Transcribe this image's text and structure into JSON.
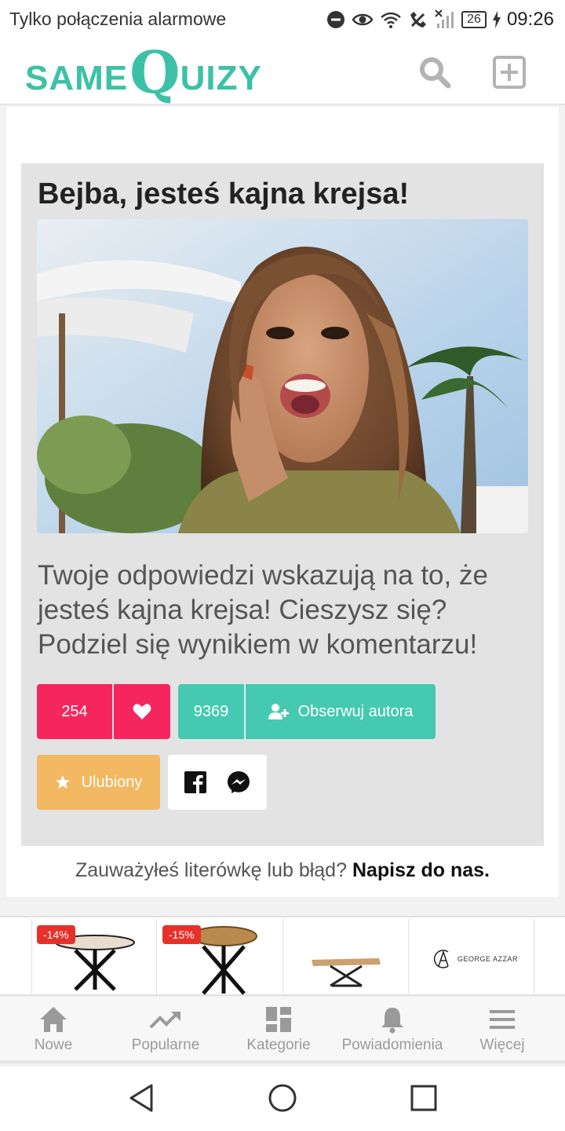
{
  "status_bar": {
    "carrier_text": "Tylko połączenia alarmowe",
    "battery": "26",
    "time": "09:26",
    "icons": [
      "do-not-disturb-icon",
      "eye-icon",
      "wifi-icon",
      "no-call-icon",
      "no-signal-icon",
      "battery-icon",
      "charging-icon"
    ]
  },
  "header": {
    "logo_part1": "SAME",
    "logo_part2": "Q",
    "logo_part3": "UIZY",
    "brand_color": "#3cc1a6",
    "icons": [
      "search-icon",
      "add-icon"
    ]
  },
  "result": {
    "title": "Bejba, jesteś kajna krejsa!",
    "description": "Twoje odpowiedzi wskazują na to, że jesteś kajna krejsa! Cieszysz się? Podziel się wynikiem w komentarzu!",
    "likes": "254",
    "followers": "9369",
    "follow_label": "Obserwuj autora",
    "favorite_label": "Ulubiony",
    "like_color": "#f5265e",
    "follow_color": "#45c9b1",
    "favorite_color": "#f2b862"
  },
  "report": {
    "prefix": "Zauważyłeś literówkę lub błąd?",
    "link": "Napisz do nas."
  },
  "ads": {
    "items": [
      {
        "badge": "-14%"
      },
      {
        "badge": "-15%"
      },
      {
        "badge": ""
      },
      {
        "brand": "GEORGE AZZAR"
      }
    ]
  },
  "bottom_nav": {
    "items": [
      {
        "label": "Nowe",
        "icon": "home-icon"
      },
      {
        "label": "Popularne",
        "icon": "trending-icon"
      },
      {
        "label": "Kategorie",
        "icon": "dashboard-icon"
      },
      {
        "label": "Powiadomienia",
        "icon": "bell-icon"
      },
      {
        "label": "Więcej",
        "icon": "menu-icon"
      }
    ]
  },
  "system_nav": {
    "icons": [
      "back-icon",
      "home-circle-icon",
      "recents-icon"
    ]
  }
}
